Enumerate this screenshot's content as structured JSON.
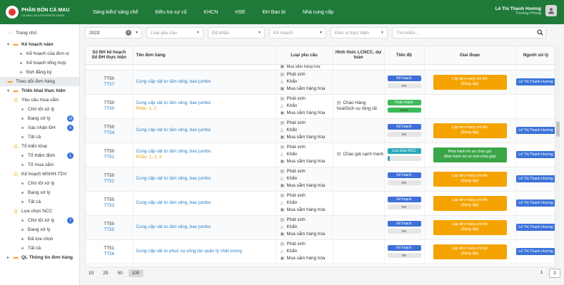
{
  "app": {
    "logo_title": "PHÂN BÓN CÀ MAU",
    "logo_sub": "CA MAU GAS-PROFERTILIZERS",
    "nav": [
      "Sáng kiến/ sáng chế",
      "Điều tra sự cố",
      "KHCN",
      "HSE",
      "ĐH Bao bì",
      "Nhà cung cấp"
    ],
    "user_name": "Lê Thị Thanh Hương",
    "user_role": "Trưởng Phòng"
  },
  "sidebar": {
    "home": "Trang chủ",
    "plan_year": "Kế hoạch năm",
    "plan_unit": "Kế hoạch của đơn vị",
    "plan_total": "Kế hoạch tổng hợp",
    "register": "Đợt đăng ký",
    "track": "Theo dõi đơn hàng",
    "deploy": "Triển khai thực hiện",
    "req_purchase": "Yêu cầu mua sắm",
    "pending": "Chờ tôi xử lý",
    "processing": "Đang xử lý",
    "processing_count": "16",
    "confirm": "Xác nhận ĐH",
    "confirm_count": "4",
    "all": "Tất cả",
    "team": "Tổ triển khai",
    "appraise": "Tổ thẩm định",
    "appraise_count": "1",
    "team_purchase": "Tổ mua sắm",
    "mshh_plan": "Kế hoạch MSHH-TDV",
    "mshh_pending": "Chờ tôi xử lý",
    "mshh_processing": "Đang xử lý",
    "mshh_all": "Tất cả",
    "ncc": "Lựa chọn NCC",
    "ncc_pending": "Chờ tôi xử lý",
    "ncc_pending_count": "7",
    "ncc_processing": "Đang xử lý",
    "ncc_selected": "Đã lựa chọn",
    "ncc_all": "Tất cả",
    "ql_info": "QL Thông tin đơn hàng"
  },
  "filters": {
    "year": "2023",
    "req_type": "Loại yêu cầu",
    "category": "Độ khẩn",
    "plan": "Kế hoạch",
    "unit": "Đơn vị thực hiện",
    "search_placeholder": "Tìm kiếm..."
  },
  "table": {
    "headers": {
      "codes": "Số ĐH kế hoạch\nSố ĐH thực hiện",
      "codes1": "Số ĐH kế hoạch",
      "codes2": "Số ĐH thực hiện",
      "name": "Tên đơn hàng",
      "req": "Loại yêu cầu",
      "form": "Hình thức LCNCC, dự toán",
      "progress": "Tiến độ",
      "stage": "Giai đoạn",
      "handler": "Người xử lý"
    },
    "partial_req": "Mua sắm hàng hóa",
    "rows": [
      {
        "code1": "TT50",
        "code2": "TT57",
        "name": "Cung cấp vật tư tấm sling, bao jumbo",
        "phan": "",
        "req": [
          "Phát sinh",
          "Khẩn",
          "Mua sắm hàng hóa"
        ],
        "form": "",
        "status": "Kế hoạch",
        "status_color": "#3f6fd8",
        "pct": "0%",
        "pct_val": 0,
        "stage1": "Lập đơn hàng chi tiết",
        "stage2": "(Đang lập)",
        "stage_color": "#f5a300",
        "handler": "Lê Thị Thanh Hương"
      },
      {
        "code1": "TT50",
        "code2": "TT50",
        "name": "Cung cấp vật tư tấm sling, bao jumbo",
        "phan": "Phần: 1, 2",
        "req": [
          "Phát sinh",
          "Khẩn",
          "Mua sắm hàng hóa"
        ],
        "form": "Chào Hàng hoá/Dịch vụ rộng rãi",
        "status": "Hoàn thành",
        "status_color": "#3fba5a",
        "pct": "100%",
        "pct_val": 100,
        "stage1": "",
        "stage2": "",
        "stage_color": "",
        "handler": ""
      },
      {
        "code1": "TT50",
        "code2": "TT54",
        "name": "Cung cấp vật tư tấm sling, bao jumbo",
        "phan": "",
        "req": [
          "Phát sinh",
          "Khẩn",
          "Mua sắm hàng hóa"
        ],
        "form": "",
        "status": "Kế hoạch",
        "status_color": "#3f6fd8",
        "pct": "0%",
        "pct_val": 0,
        "stage1": "Lập đơn hàng chi tiết",
        "stage2": "(Đang lập)",
        "stage_color": "#f5a300",
        "handler": "Lê Thị Thanh Hương"
      },
      {
        "code1": "TT50",
        "code2": "TT51",
        "name": "Cung cấp vật tư tấm sling, bao jumbo",
        "phan": "Phần: 1, 2, 3",
        "req": [
          "Phát sinh",
          "Khẩn",
          "Mua sắm hàng hóa"
        ],
        "form": "Chào giá cạnh tranh",
        "status": "Lựa chọn NCC",
        "status_color": "#2aa9b8",
        "pct": "",
        "pct_val": 8,
        "stage1": "Phát hành hồ sơ chào giá",
        "stage2": "(Ban hành hồ sơ mời chào giá)",
        "stage_color": "#3aa647",
        "handler": "Lê Thị Thanh Hương"
      },
      {
        "code1": "TT50",
        "code2": "TT52",
        "name": "Cung cấp vật tư tấm sling, bao jumbo",
        "phan": "",
        "req": [
          "Phát sinh",
          "Khẩn",
          "Mua sắm hàng hóa"
        ],
        "form": "",
        "status": "Kế hoạch",
        "status_color": "#3f6fd8",
        "pct": "0%",
        "pct_val": 0,
        "stage1": "Lập đơn hàng chi tiết",
        "stage2": "(Đang lập)",
        "stage_color": "#f5a300",
        "handler": "Lê Thị Thanh Hương"
      },
      {
        "code1": "TT50",
        "code2": "TT53",
        "name": "Cung cấp vật tư tấm sling, bao jumbo",
        "phan": "",
        "req": [
          "Phát sinh",
          "Khẩn",
          "Mua sắm hàng hóa"
        ],
        "form": "",
        "status": "Kế hoạch",
        "status_color": "#3f6fd8",
        "pct": "0%",
        "pct_val": 0,
        "stage1": "Lập đơn hàng chi tiết",
        "stage2": "(Đang lập)",
        "stage_color": "#f5a300",
        "handler": "Lê Thị Thanh Hương"
      },
      {
        "code1": "TT50",
        "code2": "TT55",
        "name": "Cung cấp vật tư tấm sling, bao jumbo",
        "phan": "",
        "req": [
          "Phát sinh",
          "Khẩn",
          "Mua sắm hàng hóa"
        ],
        "form": "",
        "status": "Kế hoạch",
        "status_color": "#3f6fd8",
        "pct": "0%",
        "pct_val": 0,
        "stage1": "Lập đơn hàng chi tiết",
        "stage2": "(Đang lập)",
        "stage_color": "#f5a300",
        "handler": "Lê Thị Thanh Hương"
      },
      {
        "code1": "TT51",
        "code2": "TT56",
        "name": "Cung cấp vật tư phục vụ công tác quản lý chất lượng",
        "phan": "",
        "req": [
          "Phát sinh",
          "Khẩn",
          "Mua sắm hàng hóa"
        ],
        "form": "",
        "status": "Kế hoạch",
        "status_color": "#3f6fd8",
        "pct": "0%",
        "pct_val": 0,
        "stage1": "Lập đơn hàng chi tiết",
        "stage2": "(Đang lập)",
        "stage_color": "#f5a300",
        "handler": "Lê Thị Thanh Hương"
      }
    ]
  },
  "pager": {
    "sizes": [
      "10",
      "25",
      "50",
      "100"
    ],
    "active_size": "100",
    "pages": [
      "1",
      "2"
    ],
    "active_page": "2"
  }
}
